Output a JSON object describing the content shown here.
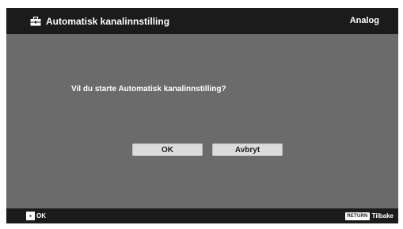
{
  "header": {
    "title": "Automatisk kanalinnstilling",
    "title_icon": "toolbox-icon",
    "mode": "Analog"
  },
  "dialog": {
    "question": "Vil du starte Automatisk kanalinnstilling?",
    "ok_label": "OK",
    "cancel_label": "Avbryt"
  },
  "footer": {
    "left_icon": "dpad-icon",
    "left_label": "OK",
    "return_key_label": "RETURN",
    "right_label": "Tilbake"
  },
  "colors": {
    "background": "#6b6b6b",
    "bars": "#1b1b1b",
    "button": "#dcdcdc",
    "text": "#ffffff"
  }
}
